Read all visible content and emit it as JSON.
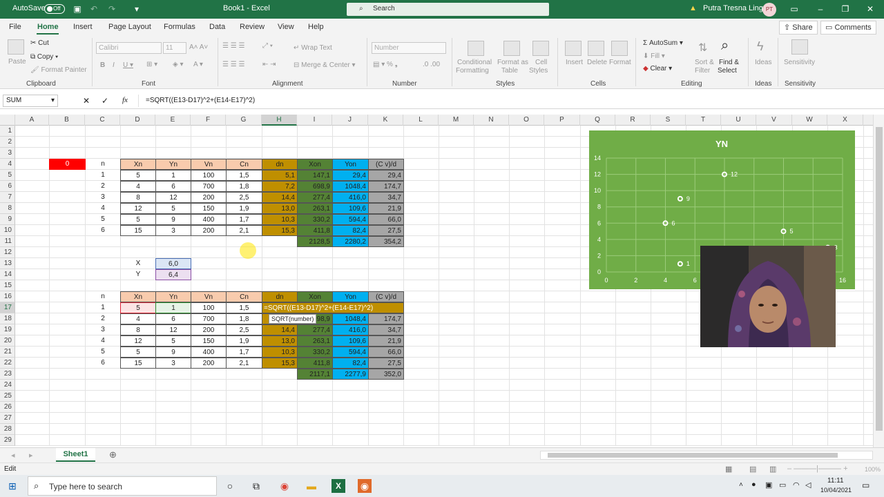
{
  "title_bar": {
    "autosave_label": "AutoSave",
    "autosave_state": "Off",
    "doc_title": "Book1 - Excel",
    "search_placeholder": "Search",
    "user_name": "Putra Tresna Linge",
    "user_initials": "PT"
  },
  "menu": {
    "tabs": [
      "File",
      "Home",
      "Insert",
      "Page Layout",
      "Formulas",
      "Data",
      "Review",
      "View",
      "Help"
    ],
    "active": "Home",
    "share_label": "Share",
    "comments_label": "Comments"
  },
  "ribbon": {
    "clipboard": {
      "paste": "Paste",
      "cut": "Cut",
      "copy": "Copy",
      "format_painter": "Format Painter",
      "label": "Clipboard"
    },
    "font": {
      "font_name": "Calibri",
      "font_size": "11",
      "label": "Font"
    },
    "alignment": {
      "wrap_text": "Wrap Text",
      "merge_center": "Merge & Center",
      "label": "Alignment"
    },
    "number": {
      "format": "Number",
      "label": "Number"
    },
    "styles": {
      "conditional_formatting": [
        "Conditional",
        "Formatting"
      ],
      "format_as_table": [
        "Format as",
        "Table"
      ],
      "cell_styles": [
        "Cell",
        "Styles"
      ],
      "label": "Styles"
    },
    "cells": {
      "insert": "Insert",
      "delete": "Delete",
      "format": "Format",
      "label": "Cells"
    },
    "editing": {
      "autosum": "AutoSum",
      "fill": "Fill",
      "clear": "Clear",
      "sort_filter": [
        "Sort &",
        "Filter"
      ],
      "find_select": [
        "Find &",
        "Select"
      ],
      "label": "Editing"
    },
    "ideas": {
      "ideas": "Ideas",
      "label": "Ideas"
    },
    "sensitivity": {
      "sensitivity": "Sensitivity",
      "label": "Sensitivity"
    }
  },
  "formula_bar": {
    "name_box": "SUM",
    "fx": "fx",
    "formula": "=SQRT((E13-D17)^2+(E14-E17)^2)"
  },
  "columns": [
    "A",
    "B",
    "C",
    "D",
    "E",
    "F",
    "G",
    "H",
    "I",
    "J",
    "K",
    "L",
    "M",
    "N",
    "O",
    "P",
    "Q",
    "R",
    "S",
    "T",
    "U",
    "V",
    "W",
    "X"
  ],
  "rows": [
    "1",
    "2",
    "3",
    "4",
    "5",
    "6",
    "7",
    "8",
    "9",
    "10",
    "11",
    "12",
    "13",
    "14",
    "15",
    "16",
    "17",
    "18",
    "19",
    "20",
    "21",
    "22",
    "23",
    "24",
    "25",
    "26",
    "27",
    "28",
    "29"
  ],
  "table1": {
    "b4": "0",
    "headers": [
      "n",
      "Xn",
      "Yn",
      "Vn",
      "Cn",
      "dn",
      "Xon",
      "Yon",
      "(C v)/d"
    ],
    "rows": [
      [
        "1",
        "5",
        "1",
        "100",
        "1,5",
        "5,1",
        "147,1",
        "29,4",
        "29,4"
      ],
      [
        "2",
        "4",
        "6",
        "700",
        "1,8",
        "7,2",
        "698,9",
        "1048,4",
        "174,7"
      ],
      [
        "3",
        "8",
        "12",
        "200",
        "2,5",
        "14,4",
        "277,4",
        "416,0",
        "34,7"
      ],
      [
        "4",
        "12",
        "5",
        "150",
        "1,9",
        "13,0",
        "263,1",
        "109,6",
        "21,9"
      ],
      [
        "5",
        "5",
        "9",
        "400",
        "1,7",
        "10,3",
        "330,2",
        "594,4",
        "66,0"
      ],
      [
        "6",
        "15",
        "3",
        "200",
        "2,1",
        "15,3",
        "411,8",
        "82,4",
        "27,5"
      ]
    ],
    "totals": [
      "2128,5",
      "2280,2",
      "354,2"
    ]
  },
  "xy": {
    "x_label": "X",
    "x_value": "6,0",
    "y_label": "Y",
    "y_value": "6,4"
  },
  "table2": {
    "headers": [
      "n",
      "Xn",
      "Yn",
      "Vn",
      "Cn",
      "dn",
      "Xon",
      "Yon",
      "(C v)/d"
    ],
    "row17": [
      "1",
      "5",
      "1",
      "100",
      "1,5"
    ],
    "editing_formula": "=SQRT((E13-D17)^2+(E14-E17)^2)",
    "tooltip": "SQRT(number)",
    "i18_partial": "98,9",
    "rows": [
      [
        "2",
        "4",
        "6",
        "700",
        "1,8",
        "",
        "",
        "1048,4",
        "174,7"
      ],
      [
        "3",
        "8",
        "12",
        "200",
        "2,5",
        "14,4",
        "277,4",
        "416,0",
        "34,7"
      ],
      [
        "4",
        "12",
        "5",
        "150",
        "1,9",
        "13,0",
        "263,1",
        "109,6",
        "21,9"
      ],
      [
        "5",
        "5",
        "9",
        "400",
        "1,7",
        "10,3",
        "330,2",
        "594,4",
        "66,0"
      ],
      [
        "6",
        "15",
        "3",
        "200",
        "2,1",
        "15,3",
        "411,8",
        "82,4",
        "27,5"
      ]
    ],
    "totals": [
      "2117,1",
      "2277,9",
      "352,0"
    ]
  },
  "chart_data": {
    "type": "scatter",
    "title": "YN",
    "xlim": [
      0,
      16
    ],
    "ylim": [
      0,
      14
    ],
    "x_ticks": [
      "0",
      "2",
      "4",
      "6",
      "16"
    ],
    "y_ticks": [
      "0",
      "2",
      "4",
      "6",
      "8",
      "10",
      "12",
      "14"
    ],
    "grid": true,
    "series": [
      {
        "x": [
          5,
          4,
          8,
          12,
          5,
          15
        ],
        "y": [
          1,
          6,
          12,
          5,
          9,
          3
        ],
        "labels": [
          "1",
          "6",
          "12",
          "5",
          "9",
          "3"
        ]
      }
    ],
    "colors": {
      "background": "#70ad47",
      "marker": "#ffffff"
    }
  },
  "sheet": {
    "tab": "Sheet1",
    "status": "Edit",
    "zoom": "100%"
  },
  "taskbar": {
    "search_placeholder": "Type here to search",
    "time": "11:11",
    "date": "10/04/2021"
  }
}
